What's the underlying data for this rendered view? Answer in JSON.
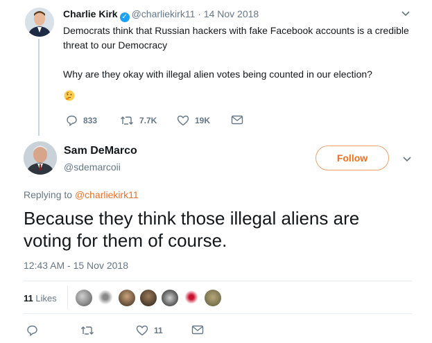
{
  "parent_tweet": {
    "name": "Charlie Kirk",
    "handle_date": "@charliekirk11 · 14 Nov 2018",
    "text_lines": [
      "Democrats think that Russian hackers with fake Facebook accounts is a credible",
      "threat to our Democracy",
      "",
      "Why are they okay with illegal alien votes being counted in our election?"
    ],
    "emoji": "thinking-face",
    "reply_count": "833",
    "retweet_count": "7.7K",
    "like_count": "19K"
  },
  "reply_tweet": {
    "name": "Sam DeMarco",
    "handle": "@sdemarcoii",
    "follow_label": "Follow",
    "replying_prefix": "Replying to",
    "replying_to": "@charliekirk11",
    "text": "Because they think those illegal aliens are voting for them of course.",
    "timestamp": "12:43 AM - 15 Nov 2018",
    "likes_count": "11",
    "likes_label": "Likes",
    "action_like_count": "11"
  },
  "colors": {
    "accent": "#f26f21",
    "muted": "#657786",
    "verified": "#1da1f2",
    "text": "#14171a"
  }
}
